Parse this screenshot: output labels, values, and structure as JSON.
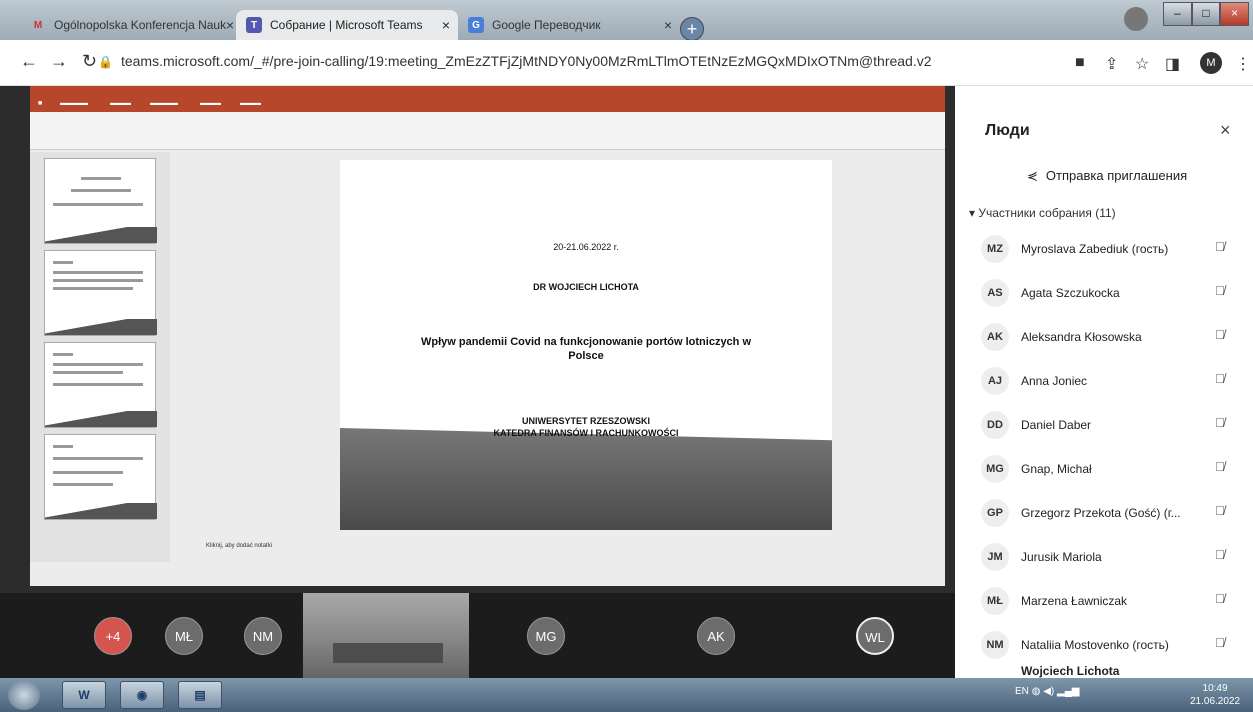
{
  "browser": {
    "tabs": [
      {
        "label": "Ogólnopolska Konferencja Nauk",
        "icon": "gmail-icon"
      },
      {
        "label": "Собрание | Microsoft Teams",
        "icon": "teams-icon"
      },
      {
        "label": "Google Переводчик",
        "icon": "translate-icon"
      }
    ],
    "url": "teams.microsoft.com/_#/pre-join-calling/19:meeting_ZmEzZTFjZjMtNDY0Ny00MzRmLTlmOTEtNzEzMGQxMDIxOTNm@thread.v2",
    "profile_initial": "M"
  },
  "presentation": {
    "date": "20-21.06.2022 r.",
    "author": "DR WOJCIECH LICHOTA",
    "title_line1": "Wpływ pandemii Covid na funkcjonowanie portów lotniczych w",
    "title_line2": "Polsce",
    "university": "UNIWERSYTET RZESZOWSKI",
    "department": "KATEDRA FINANSÓW I RACHUNKOWOŚCI",
    "notes": "Kliknij, aby dodać notatki"
  },
  "strip": {
    "count_badge": "+4",
    "circles": [
      "MŁ",
      "NM",
      "MG",
      "AK",
      "WL"
    ]
  },
  "people": {
    "title": "Люди",
    "invite_label": "Отправка приглашения",
    "section_label": "Участники собрания (11)",
    "participants": [
      {
        "initials": "MZ",
        "name": "Myroslava Zabediuk (гость)"
      },
      {
        "initials": "AS",
        "name": "Agata Szczukocka"
      },
      {
        "initials": "AK",
        "name": "Aleksandra Kłosowska"
      },
      {
        "initials": "AJ",
        "name": "Anna Joniec"
      },
      {
        "initials": "DD",
        "name": "Daniel Daber"
      },
      {
        "initials": "MG",
        "name": "Gnap, Michał"
      },
      {
        "initials": "GP",
        "name": "Grzegorz Przekota (Gość) (г..."
      },
      {
        "initials": "JM",
        "name": "Jurusik Mariola"
      },
      {
        "initials": "MŁ",
        "name": "Marzena Ławniczak"
      },
      {
        "initials": "NM",
        "name": "Nataliia Mostovenko (гость)"
      },
      {
        "initials": "WL",
        "name": "Wojciech Lichota"
      }
    ]
  },
  "taskbar": {
    "lang": "EN",
    "time": "10:49",
    "date": "21.06.2022"
  }
}
